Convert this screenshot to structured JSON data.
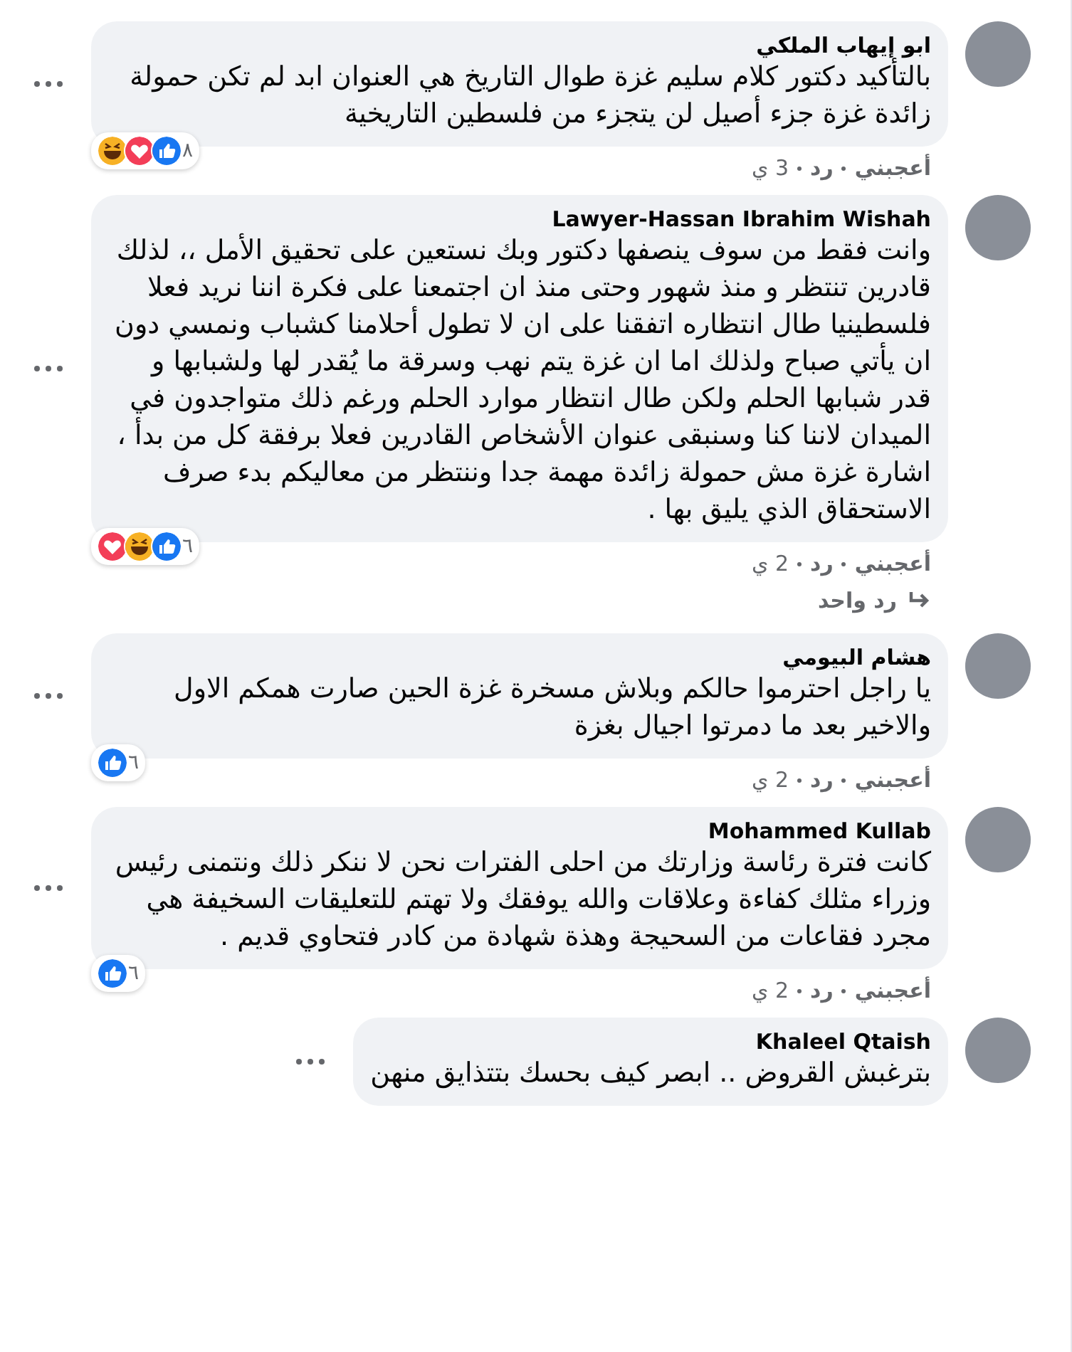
{
  "comments": [
    {
      "author": "ابو إيهاب الملكي",
      "text": "بالتأكيد دكتور كلام سليم غزة طوال التاريخ هي العنوان ابد لم تكن حمولة زائدة غزة جزء أصيل لن يتجزء من فلسطين التاريخية",
      "reactions": [
        {
          "kind": "like"
        },
        {
          "kind": "love"
        },
        {
          "kind": "haha"
        }
      ],
      "reaction_count": "٨",
      "like": "أعجبني",
      "reply": "رد",
      "time": "3 ي"
    },
    {
      "author": "Lawyer-Hassan Ibrahim Wishah",
      "text": "وانت فقط من سوف ينصفها دكتور وبك نستعين على تحقيق الأمل ،، لذلك قادرين تنتظر و منذ شهور وحتى منذ ان اجتمعنا على فكرة اننا نريد فعلا فلسطينيا طال انتظاره اتفقنا على ان لا تطول أحلامنا كشباب ونمسي دون ان يأتي صباح ولذلك اما ان غزة يتم نهب وسرقة ما يُقدر لها ولشبابها و قدر شبابها الحلم ولكن طال انتظار موارد الحلم ورغم ذلك متواجدون في الميدان لاننا كنا وسنبقى عنوان الأشخاص القادرين فعلا برفقة كل من بدأ ، اشارة غزة مش حمولة زائدة مهمة جدا وننتظر من معاليكم بدء صرف الاستحقاق الذي يليق بها .",
      "reactions": [
        {
          "kind": "like"
        },
        {
          "kind": "haha"
        },
        {
          "kind": "love"
        }
      ],
      "reaction_count": "٦",
      "like": "أعجبني",
      "reply": "رد",
      "time": "2 ي",
      "replies_link": "رد واحد"
    },
    {
      "author": "هشام البيومي",
      "text": "يا راجل احترموا حالكم وبلاش مسخرة غزة الحين صارت همكم الاول والاخير بعد ما دمرتوا اجيال بغزة",
      "reactions": [
        {
          "kind": "like"
        }
      ],
      "reaction_count": "٦",
      "like": "أعجبني",
      "reply": "رد",
      "time": "2 ي"
    },
    {
      "author": "Mohammed Kullab",
      "text": "كانت فترة رئاسة وزارتك من احلى الفترات نحن لا ننكر ذلك ونتمنى رئيس وزراء مثلك كفاءة وعلاقات والله يوفقك ولا تهتم للتعليقات السخيفة هي مجرد فقاعات من السحيجة وهذة شهادة من كادر فتحاوي قديم .",
      "reactions": [
        {
          "kind": "like"
        }
      ],
      "reaction_count": "٦",
      "like": "أعجبني",
      "reply": "رد",
      "time": "2 ي"
    },
    {
      "author": "Khaleel Qtaish",
      "text": "بترغبش القروض .. ابصر كيف بحسك بتتذايق منهن"
    }
  ]
}
